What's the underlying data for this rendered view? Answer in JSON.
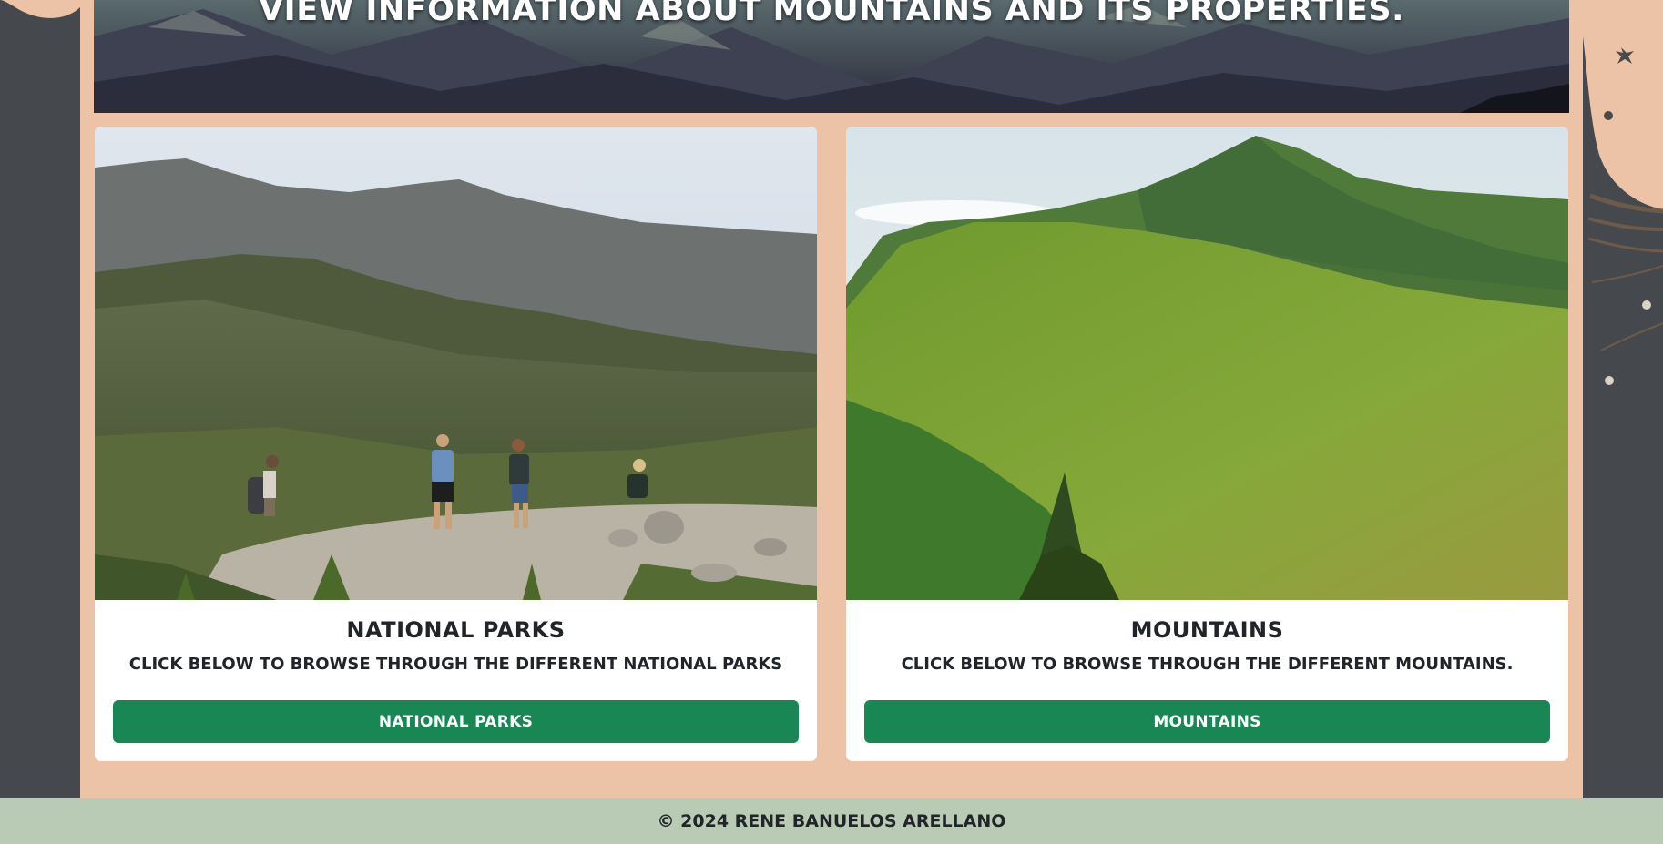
{
  "hero": {
    "title": "View information about mountains and its properties."
  },
  "cards": [
    {
      "title": "National Parks",
      "text": "Click below to browse through the different national parks",
      "button_label": "National Parks",
      "image_alt": "Hikers walking across a rocky summit with mountain ridges behind"
    },
    {
      "title": "Mountains",
      "text": "Click below to browse through the different mountains.",
      "button_label": "Mountains",
      "image_alt": "Forested green mountain peak under a pale sky"
    }
  ],
  "footer": {
    "copyright": "© 2024 Rene Banuelos Arellano"
  },
  "colors": {
    "page_background": "#45494e",
    "panel_background": "#ecc3a6",
    "button_green": "#198754",
    "footer_background": "#b9cbb4"
  }
}
